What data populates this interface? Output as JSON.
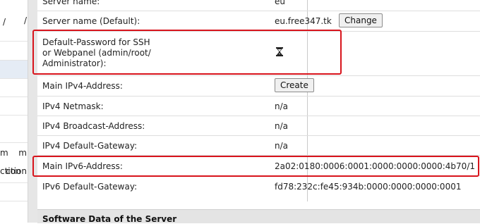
{
  "left_nav": {
    "items": [
      {
        "text": "/"
      },
      {
        "text": ""
      },
      {
        "text": ""
      },
      {
        "text": ""
      },
      {
        "text": ""
      },
      {
        "text": "m"
      },
      {
        "text": "ction"
      },
      {
        "text": ""
      },
      {
        "text": ""
      }
    ]
  },
  "server_info": {
    "top_partial": {
      "label": "Server name:",
      "value": "eu"
    },
    "rows": [
      {
        "label": "Server name (Default):",
        "value": "eu.free347.tk",
        "button": "Change"
      },
      {
        "label_lines": [
          "Default-Password for SSH",
          "or Webpanel (admin/root/",
          "Administrator):"
        ],
        "value_icon": "hourglass-icon"
      },
      {
        "label": "Main IPv4-Address:",
        "button": "Create"
      },
      {
        "label": "IPv4 Netmask:",
        "value": "n/a"
      },
      {
        "label": "IPv4 Broadcast-Address:",
        "value": "n/a"
      },
      {
        "label": "IPv4 Default-Gateway:",
        "value": "n/a"
      },
      {
        "label": "Main IPv6-Address:",
        "value": "2a02:0180:0006:0001:0000:0000:0000:4b70/1"
      },
      {
        "label": "IPv6 Default-Gateway:",
        "value": "fd78:232c:fe45:934b:0000:0000:0000:0001"
      }
    ]
  },
  "software_section": {
    "title": "Software Data of the Server"
  },
  "colors": {
    "highlight": "#d8141c",
    "gutter": "#e6e6e6"
  }
}
